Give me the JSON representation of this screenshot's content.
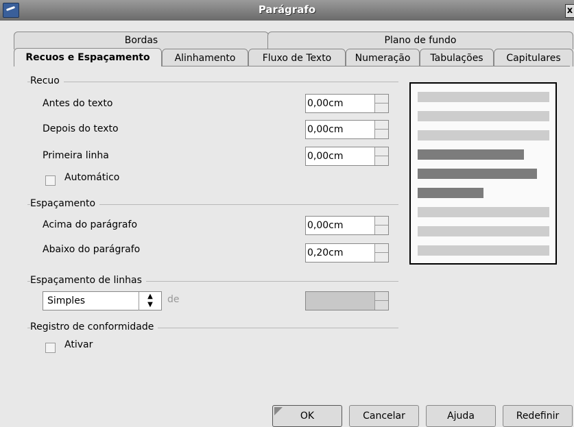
{
  "window": {
    "title": "Parágrafo",
    "close_label": "x"
  },
  "tabs": {
    "row_top": [
      "Bordas",
      "Plano de fundo"
    ],
    "row_bottom": [
      "Recuos e Espaçamento",
      "Alinhamento",
      "Fluxo de Texto",
      "Numeração",
      "Tabulações",
      "Capitulares"
    ],
    "active": "Recuos e Espaçamento"
  },
  "indent": {
    "group_label": "Recuo",
    "before_text_label": "Antes do texto",
    "before_text_value": "0,00cm",
    "after_text_label": "Depois do texto",
    "after_text_value": "0,00cm",
    "first_line_label": "Primeira linha",
    "first_line_value": "0,00cm",
    "automatic_label": "Automático",
    "automatic_checked": false
  },
  "spacing": {
    "group_label": "Espaçamento",
    "above_label": "Acima do parágrafo",
    "above_value": "0,00cm",
    "below_label": "Abaixo do parágrafo",
    "below_value": "0,20cm"
  },
  "line_spacing": {
    "group_label": "Espaçamento de linhas",
    "selected": "Simples",
    "of_label": "de",
    "of_value": ""
  },
  "register": {
    "group_label": "Registro de conformidade",
    "activate_label": "Ativar",
    "activate_checked": false
  },
  "buttons": {
    "ok": "OK",
    "cancel": "Cancelar",
    "help": "Ajuda",
    "reset": "Redefinir"
  }
}
